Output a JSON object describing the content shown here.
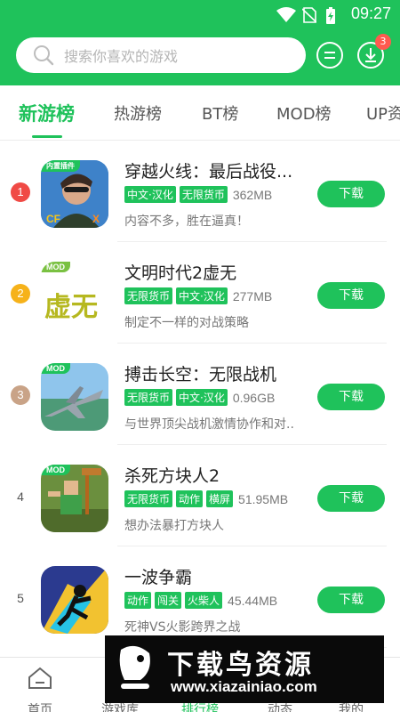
{
  "status": {
    "time": "09:27"
  },
  "search": {
    "placeholder": "搜索你喜欢的游戏"
  },
  "header": {
    "download_badge": "3"
  },
  "tabs": [
    {
      "label": "新游榜",
      "active": true
    },
    {
      "label": "热游榜"
    },
    {
      "label": "BT榜"
    },
    {
      "label": "MOD榜"
    },
    {
      "label": "UP资"
    }
  ],
  "games": [
    {
      "rank": "1",
      "title": "穿越火线：最后战役...",
      "tags": [
        "中文·汉化",
        "无限货币"
      ],
      "size": "362MB",
      "desc": "内容不多，胜在逼真！",
      "icon_label": "内置插件",
      "button": "下载"
    },
    {
      "rank": "2",
      "title": "文明时代2虚无",
      "tags": [
        "无限货币",
        "中文·汉化"
      ],
      "size": "277MB",
      "desc": "制定不一样的对战策略",
      "icon_label": "MOD",
      "icon_text": "虚无",
      "button": "下载"
    },
    {
      "rank": "3",
      "title": "搏击长空：无限战机",
      "tags": [
        "无限货币",
        "中文·汉化"
      ],
      "size": "0.96GB",
      "desc": "与世界顶尖战机激情协作和对...",
      "icon_label": "MOD",
      "button": "下载"
    },
    {
      "rank": "4",
      "title": "杀死方块人2",
      "tags": [
        "无限货币",
        "动作",
        "横屏"
      ],
      "size": "51.95MB",
      "desc": "想办法暴打方块人",
      "icon_label": "MOD",
      "button": "下载"
    },
    {
      "rank": "5",
      "title": "一波争霸",
      "tags": [
        "动作",
        "闯关",
        "火柴人"
      ],
      "size": "45.44MB",
      "desc": "死神VS火影跨界之战",
      "button": "下载"
    }
  ],
  "bottom_nav": [
    {
      "label": "首页"
    },
    {
      "label": "游戏库"
    },
    {
      "label": "排行榜"
    },
    {
      "label": "动态"
    },
    {
      "label": "我的"
    }
  ],
  "watermark": {
    "title": "下载鸟资源",
    "url": "www.xiazainiao.com"
  },
  "colors": {
    "primary": "#1fc25b",
    "rank1": "#f04a45",
    "rank2": "#f6b21a",
    "rank3": "#c9a387"
  }
}
